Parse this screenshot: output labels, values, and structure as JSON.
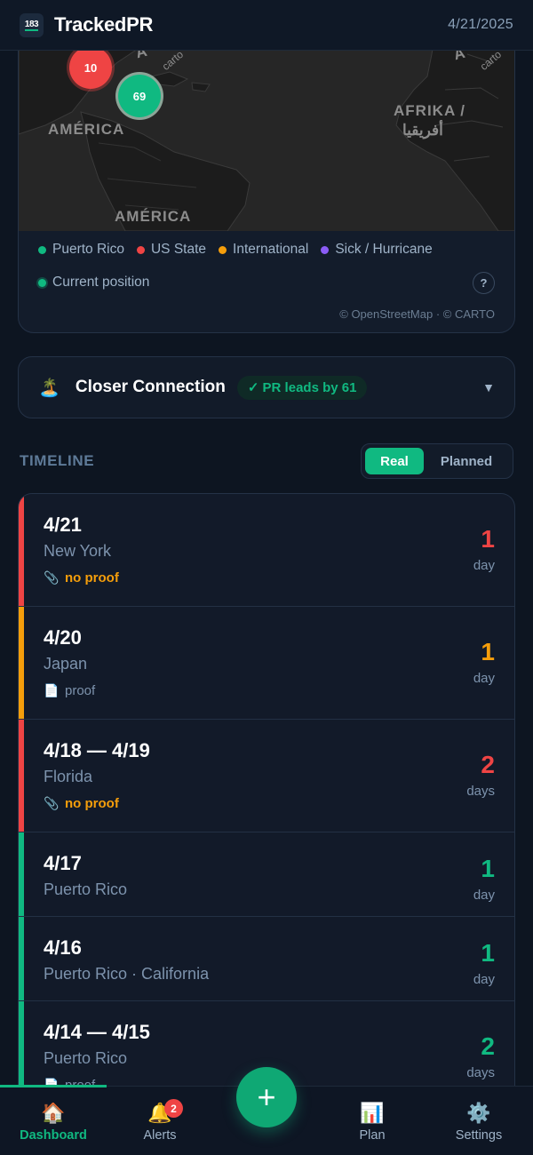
{
  "header": {
    "logo_text": "183",
    "app_title": "TrackedPR",
    "date": "4/21/2025"
  },
  "map": {
    "labels": {
      "america_top": "AMÉRICA",
      "america_bottom": "AMÉRICA",
      "afrika_line1": "AFRIKA /",
      "afrika_line2": "أفريقيا",
      "a_left": "A",
      "a_right": "A",
      "carto_left": "carto",
      "carto_right": "carto"
    },
    "clusters": [
      {
        "label": "10",
        "color": "#ef4444"
      },
      {
        "label": "69",
        "color": "#10b981"
      }
    ],
    "legend": [
      {
        "label": "Puerto Rico",
        "color": "#10b981"
      },
      {
        "label": "US State",
        "color": "#ef4444"
      },
      {
        "label": "International",
        "color": "#f59e0b"
      },
      {
        "label": "Sick / Hurricane",
        "color": "#8b5cf6"
      },
      {
        "label": "Current position",
        "color": "#10b981"
      }
    ],
    "help_label": "?",
    "attribution": "© OpenStreetMap · © CARTO"
  },
  "connection": {
    "icon": "island-icon",
    "title": "Closer Connection",
    "badge": "✓ PR leads by 61",
    "chevron": "▼"
  },
  "timeline": {
    "heading": "TIMELINE",
    "toggle": {
      "real": "Real",
      "planned": "Planned",
      "selected": "Real"
    },
    "entries": [
      {
        "date": "4/21",
        "place": "New York",
        "proof": "no proof",
        "proof_state": "missing",
        "count": "1",
        "unit": "day",
        "color": "#ef4444"
      },
      {
        "date": "4/20",
        "place": "Japan",
        "proof": "proof",
        "proof_state": "attached",
        "count": "1",
        "unit": "day",
        "color": "#f59e0b"
      },
      {
        "date": "4/18 — 4/19",
        "place": "Florida",
        "proof": "no proof",
        "proof_state": "missing",
        "count": "2",
        "unit": "days",
        "color": "#ef4444"
      },
      {
        "date": "4/17",
        "place": "Puerto Rico",
        "proof": "",
        "proof_state": "",
        "count": "1",
        "unit": "day",
        "color": "#10b981"
      },
      {
        "date": "4/16",
        "place": "Puerto Rico · California",
        "proof": "",
        "proof_state": "",
        "count": "1",
        "unit": "day",
        "color": "#10b981"
      },
      {
        "date": "4/14 — 4/15",
        "place": "Puerto Rico",
        "proof": "proof",
        "proof_state": "attached",
        "count": "2",
        "unit": "days",
        "color": "#10b981"
      }
    ]
  },
  "nav": {
    "items": [
      {
        "label": "Dashboard",
        "icon": "house-icon",
        "active": true
      },
      {
        "label": "Alerts",
        "icon": "bell-icon",
        "badge": "2"
      },
      {
        "label": "Plan",
        "icon": "bar-chart-icon"
      },
      {
        "label": "Settings",
        "icon": "gear-icon"
      }
    ],
    "fab_label": "+"
  },
  "colors": {
    "accent": "#10b981",
    "us_state": "#ef4444",
    "international": "#f59e0b",
    "sick": "#8b5cf6",
    "background": "#0d1521"
  }
}
